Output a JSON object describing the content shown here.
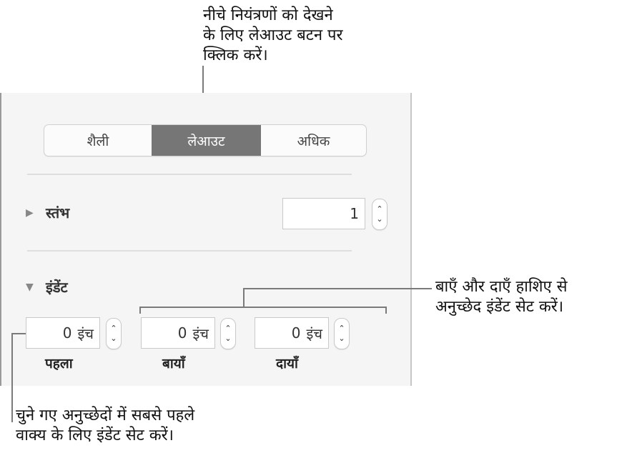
{
  "callouts": {
    "top": [
      "नीचे नियंत्रणों को देखने",
      "के लिए लेआउट बटन पर",
      "क्लिक करें।"
    ],
    "right": [
      "बाएँ और दाएँ हाशिए से",
      "अनुच्छेद इंडेंट सेट करें।"
    ],
    "bottom": [
      "चुने गए अनुच्छेदों में सबसे पहले",
      "वाक्य के लिए इंडेंट सेट करें।"
    ]
  },
  "tabs": [
    {
      "label": "शैली",
      "selected": false
    },
    {
      "label": "लेआउट",
      "selected": true
    },
    {
      "label": "अधिक",
      "selected": false
    }
  ],
  "columns": {
    "label": "स्तंभ",
    "expanded": false,
    "value": "1"
  },
  "indent": {
    "label": "इंडेंट",
    "expanded": true,
    "unit": "इंच",
    "fields": [
      {
        "label": "पहला",
        "value": "0"
      },
      {
        "label": "बायाँ",
        "value": "0"
      },
      {
        "label": "दायाँ",
        "value": "0"
      }
    ]
  },
  "icons": {
    "collapsed": "▶",
    "expanded": "▼",
    "stepper_up": "⌃",
    "stepper_down": "⌄"
  }
}
